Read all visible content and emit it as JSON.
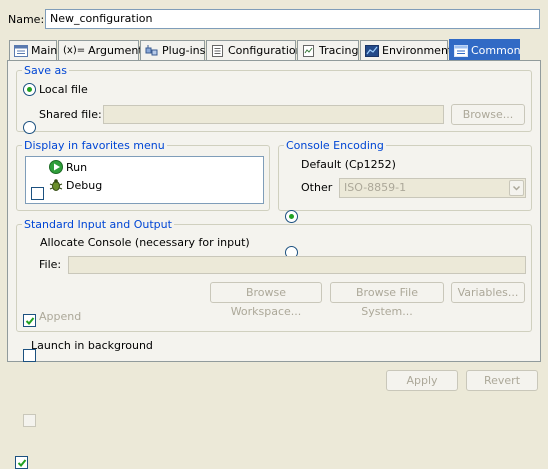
{
  "name": {
    "label": "Name:",
    "value": "New_configuration"
  },
  "tabs": [
    {
      "label": "Main",
      "icon": "main-tab-icon"
    },
    {
      "label": "Arguments",
      "icon": "variable-x-icon"
    },
    {
      "label": "Plug-ins",
      "icon": "plugin-icon"
    },
    {
      "label": "Configuration",
      "icon": "configuration-icon"
    },
    {
      "label": "Tracing",
      "icon": "tracing-icon"
    },
    {
      "label": "Environment",
      "icon": "environment-icon"
    },
    {
      "label": "Common",
      "icon": "common-icon",
      "active": true
    }
  ],
  "arguments_prefix": "(x)=",
  "save_as": {
    "title": "Save as",
    "local_file": "Local file",
    "shared_file": "Shared file:",
    "shared_value": "",
    "browse": "Browse..."
  },
  "favorites": {
    "title": "Display in favorites menu",
    "items": [
      {
        "label": "Run",
        "icon": "run-icon",
        "checked": false
      },
      {
        "label": "Debug",
        "icon": "debug-bug-icon",
        "checked": false
      }
    ]
  },
  "encoding": {
    "title": "Console Encoding",
    "default": "Default (Cp1252)",
    "other": "Other",
    "other_value": "ISO-8859-1"
  },
  "std_io": {
    "title": "Standard Input and Output",
    "allocate": "Allocate Console (necessary for input)",
    "file": "File:",
    "file_value": "",
    "browse_workspace": "Browse Workspace...",
    "browse_fs": "Browse File System...",
    "variables": "Variables...",
    "append": "Append"
  },
  "launch_bg": "Launch in background",
  "buttons": {
    "apply": "Apply",
    "revert": "Revert"
  },
  "colors": {
    "accent": "#316ac5",
    "group_title": "#0046d5",
    "background": "#ece9d8",
    "panel": "#f4f3ee"
  }
}
